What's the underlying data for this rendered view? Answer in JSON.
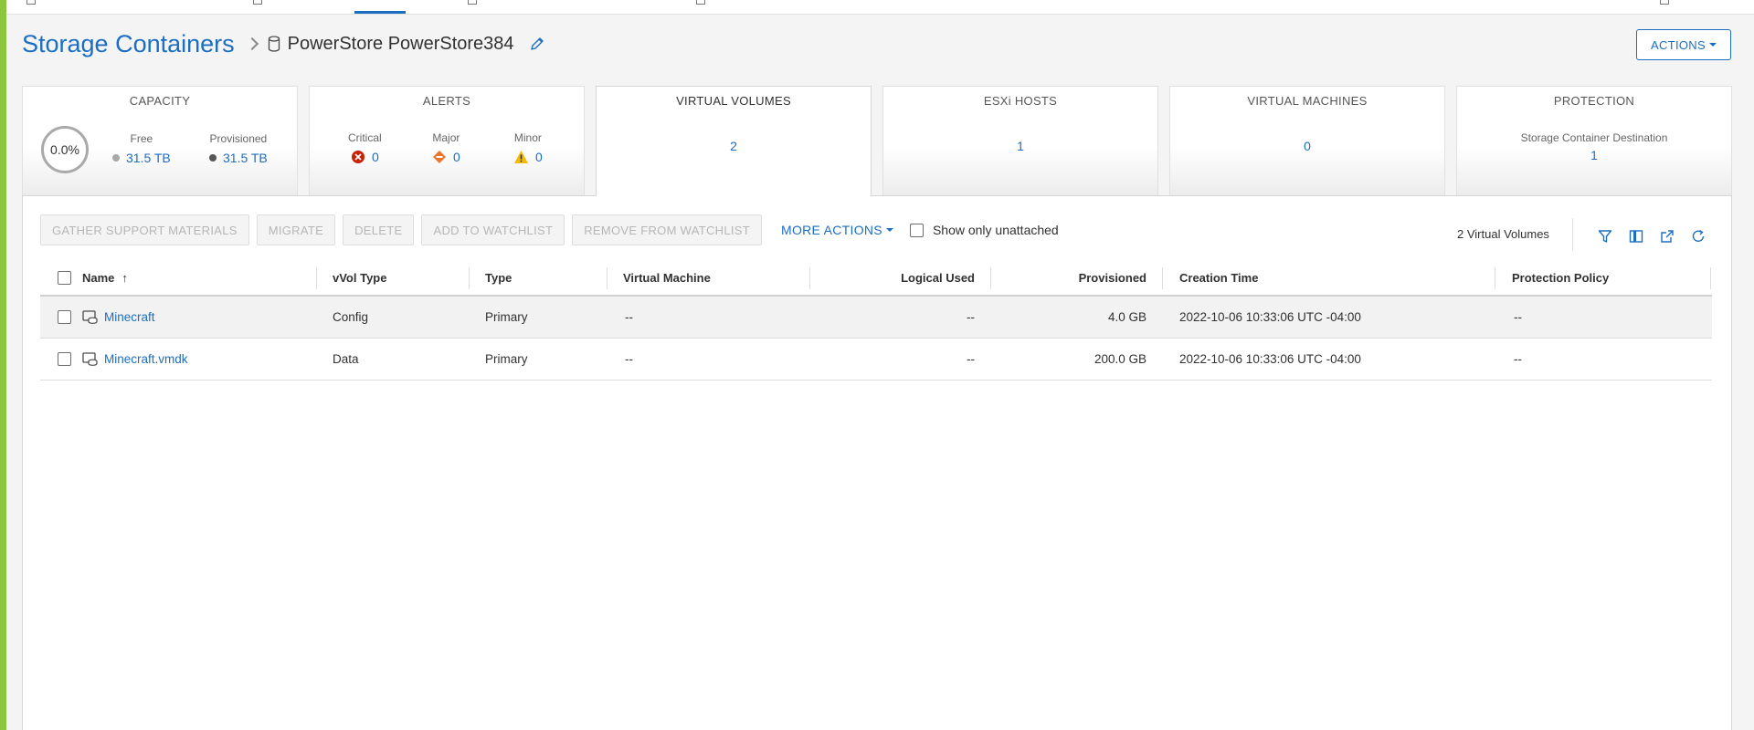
{
  "breadcrumb": {
    "parent": "Storage Containers",
    "current": "PowerStore PowerStore384"
  },
  "header": {
    "actions_label": "ACTIONS"
  },
  "cards": {
    "capacity": {
      "title": "CAPACITY",
      "percent": "0.0%",
      "free_label": "Free",
      "free_value": "31.5 TB",
      "provisioned_label": "Provisioned",
      "provisioned_value": "31.5 TB"
    },
    "alerts": {
      "title": "ALERTS",
      "critical_label": "Critical",
      "critical_value": "0",
      "major_label": "Major",
      "major_value": "0",
      "minor_label": "Minor",
      "minor_value": "0"
    },
    "virtual_volumes": {
      "title": "VIRTUAL VOLUMES",
      "value": "2"
    },
    "esxi_hosts": {
      "title": "ESXi HOSTS",
      "value": "1"
    },
    "virtual_machines": {
      "title": "VIRTUAL MACHINES",
      "value": "0"
    },
    "protection": {
      "title": "PROTECTION",
      "label": "Storage Container Destination",
      "value": "1"
    }
  },
  "toolbar": {
    "gather": "GATHER SUPPORT MATERIALS",
    "migrate": "MIGRATE",
    "delete": "DELETE",
    "add_watch": "ADD TO WATCHLIST",
    "remove_watch": "REMOVE FROM WATCHLIST",
    "more_actions": "MORE ACTIONS",
    "show_unattached": "Show only unattached",
    "count": "2 Virtual Volumes"
  },
  "table": {
    "columns": {
      "name": "Name",
      "vvol_type": "vVol Type",
      "type": "Type",
      "vm": "Virtual Machine",
      "logical_used": "Logical Used",
      "provisioned": "Provisioned",
      "creation_time": "Creation Time",
      "protection_policy": "Protection Policy"
    },
    "rows": [
      {
        "name": "Minecraft",
        "vvol_type": "Config",
        "type": "Primary",
        "vm": "--",
        "logical_used": "--",
        "provisioned": "4.0 GB",
        "creation_time": "2022-10-06 10:33:06 UTC -04:00",
        "protection_policy": "--"
      },
      {
        "name": "Minecraft.vmdk",
        "vvol_type": "Data",
        "type": "Primary",
        "vm": "--",
        "logical_used": "--",
        "provisioned": "200.0 GB",
        "creation_time": "2022-10-06 10:33:06 UTC -04:00",
        "protection_policy": "--"
      }
    ]
  },
  "colors": {
    "accent": "#1b6ec2",
    "critical": "#c92100",
    "major": "#e8762d",
    "minor": "#f5b800",
    "frame": "#8cc63f"
  },
  "icons": [
    "database-icon",
    "pencil-icon",
    "filter-icon",
    "columns-icon",
    "export-icon",
    "refresh-icon",
    "vm-disk-icon",
    "critical-icon",
    "major-icon",
    "minor-icon"
  ]
}
